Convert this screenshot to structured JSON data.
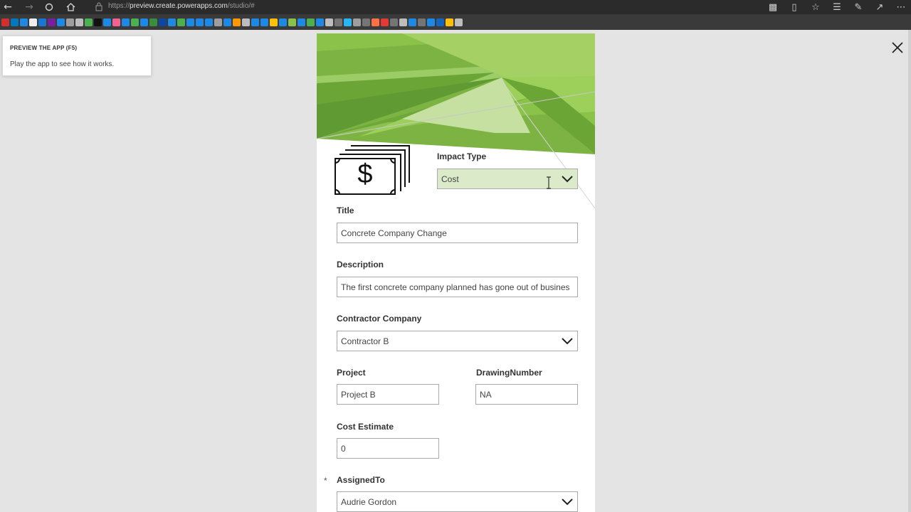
{
  "browser": {
    "url_prefix": "https://",
    "url_host": "preview.create.powerapps.com",
    "url_path": "/studio/#"
  },
  "tooltip": {
    "title": "PREVIEW THE APP (F5)",
    "text": "Play the app to see how it works."
  },
  "form": {
    "impact_type": {
      "label": "Impact Type",
      "value": "Cost"
    },
    "title": {
      "label": "Title",
      "value": "Concrete Company Change"
    },
    "description": {
      "label": "Description",
      "value": "The first concrete company planned has gone out of busines"
    },
    "contractor_company": {
      "label": "Contractor Company",
      "value": "Contractor B"
    },
    "project": {
      "label": "Project",
      "value": "Project B"
    },
    "drawing_number": {
      "label": "DrawingNumber",
      "value": "NA"
    },
    "cost_estimate": {
      "label": "Cost Estimate",
      "value": "0"
    },
    "assigned_to": {
      "label": "AssignedTo",
      "value": "Audrie Gordon",
      "required_mark": "*"
    }
  },
  "colors": {
    "impact_fill": "#dbeac9",
    "banner_green": "#7cb342"
  }
}
